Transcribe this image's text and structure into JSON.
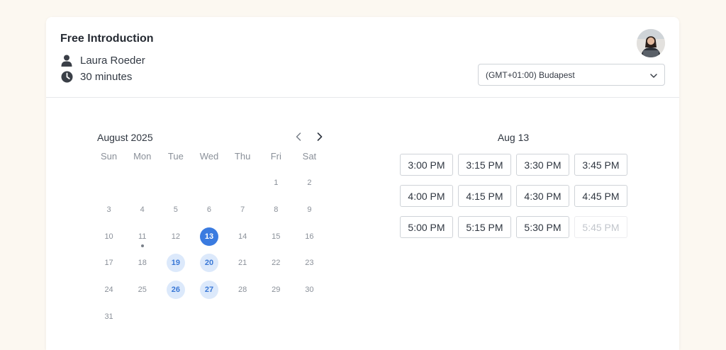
{
  "event": {
    "title": "Free Introduction",
    "host": "Laura Roeder",
    "duration": "30 minutes"
  },
  "timezone": {
    "selected": "(GMT+01:00) Budapest"
  },
  "calendar": {
    "month_label": "August 2025",
    "weekdays": [
      "Sun",
      "Mon",
      "Tue",
      "Wed",
      "Thu",
      "Fri",
      "Sat"
    ],
    "weeks": [
      [
        "",
        "",
        "",
        "",
        "",
        "1",
        "2"
      ],
      [
        "3",
        "4",
        "5",
        "6",
        "7",
        "8",
        "9"
      ],
      [
        "10",
        "11",
        "12",
        "13",
        "14",
        "15",
        "16"
      ],
      [
        "17",
        "18",
        "19",
        "20",
        "21",
        "22",
        "23"
      ],
      [
        "24",
        "25",
        "26",
        "27",
        "28",
        "29",
        "30"
      ],
      [
        "31",
        "",
        "",
        "",
        "",
        "",
        ""
      ]
    ],
    "today": "11",
    "selected": "13",
    "available": [
      "19",
      "20",
      "26",
      "27"
    ]
  },
  "slots": {
    "date_label": "Aug 13",
    "times": [
      {
        "label": "3:00 PM",
        "enabled": true
      },
      {
        "label": "3:15 PM",
        "enabled": true
      },
      {
        "label": "3:30 PM",
        "enabled": true
      },
      {
        "label": "3:45 PM",
        "enabled": true
      },
      {
        "label": "4:00 PM",
        "enabled": true
      },
      {
        "label": "4:15 PM",
        "enabled": true
      },
      {
        "label": "4:30 PM",
        "enabled": true
      },
      {
        "label": "4:45 PM",
        "enabled": true
      },
      {
        "label": "5:00 PM",
        "enabled": true
      },
      {
        "label": "5:15 PM",
        "enabled": true
      },
      {
        "label": "5:30 PM",
        "enabled": true
      },
      {
        "label": "5:45 PM",
        "enabled": false
      }
    ]
  },
  "colors": {
    "accent": "#3a7be0",
    "available_bg": "#dce9fb",
    "page_bg": "#fcf8f1"
  },
  "icons": {
    "host": "person-icon",
    "duration": "clock-icon",
    "prev": "chevron-left-icon",
    "next": "chevron-right-icon",
    "select": "chevron-down-icon"
  }
}
